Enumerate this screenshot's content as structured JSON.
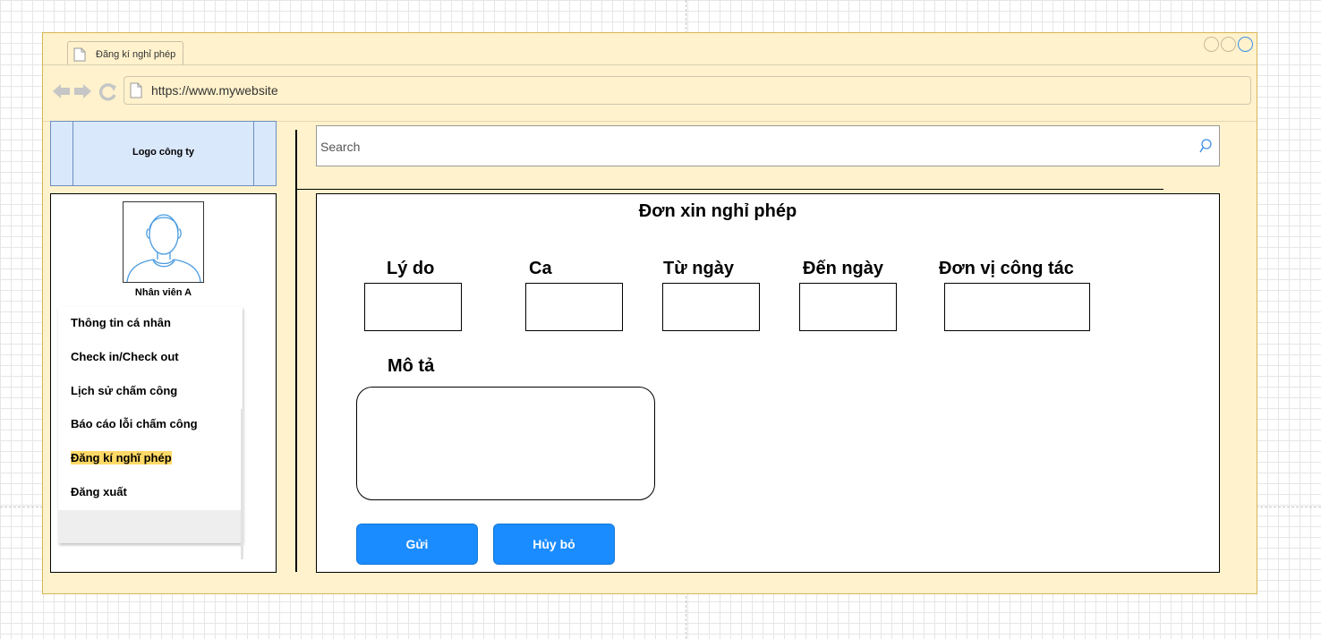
{
  "browser": {
    "tab_title": "Đăng kí nghỉ phép",
    "url": "https://www.mywebsite"
  },
  "logo": {
    "label": "Logo công ty"
  },
  "search": {
    "placeholder": "Search"
  },
  "user": {
    "name": "Nhân viên A"
  },
  "menu": {
    "items": [
      {
        "label": "Thông tin cá nhân"
      },
      {
        "label": "Check in/Check out"
      },
      {
        "label": "Lịch sử chấm công"
      },
      {
        "label": "Báo cáo lỗi chấm công"
      },
      {
        "label": "Đăng kí nghĩ phép",
        "active": true
      },
      {
        "label": "Đăng xuất"
      }
    ]
  },
  "form": {
    "title": "Đơn xin nghỉ phép",
    "fields": [
      {
        "label": "Lý do"
      },
      {
        "label": "Ca"
      },
      {
        "label": "Từ ngày"
      },
      {
        "label": "Đến ngày"
      },
      {
        "label": "Đơn vị công tác"
      }
    ],
    "description_label": "Mô tả",
    "submit_label": "Gửi",
    "cancel_label": "Hủy bỏ"
  },
  "colors": {
    "window_bg": "#fff2cc",
    "logo_bg": "#dae8fc",
    "highlight": "#ffd966",
    "button": "#1a8cff"
  }
}
